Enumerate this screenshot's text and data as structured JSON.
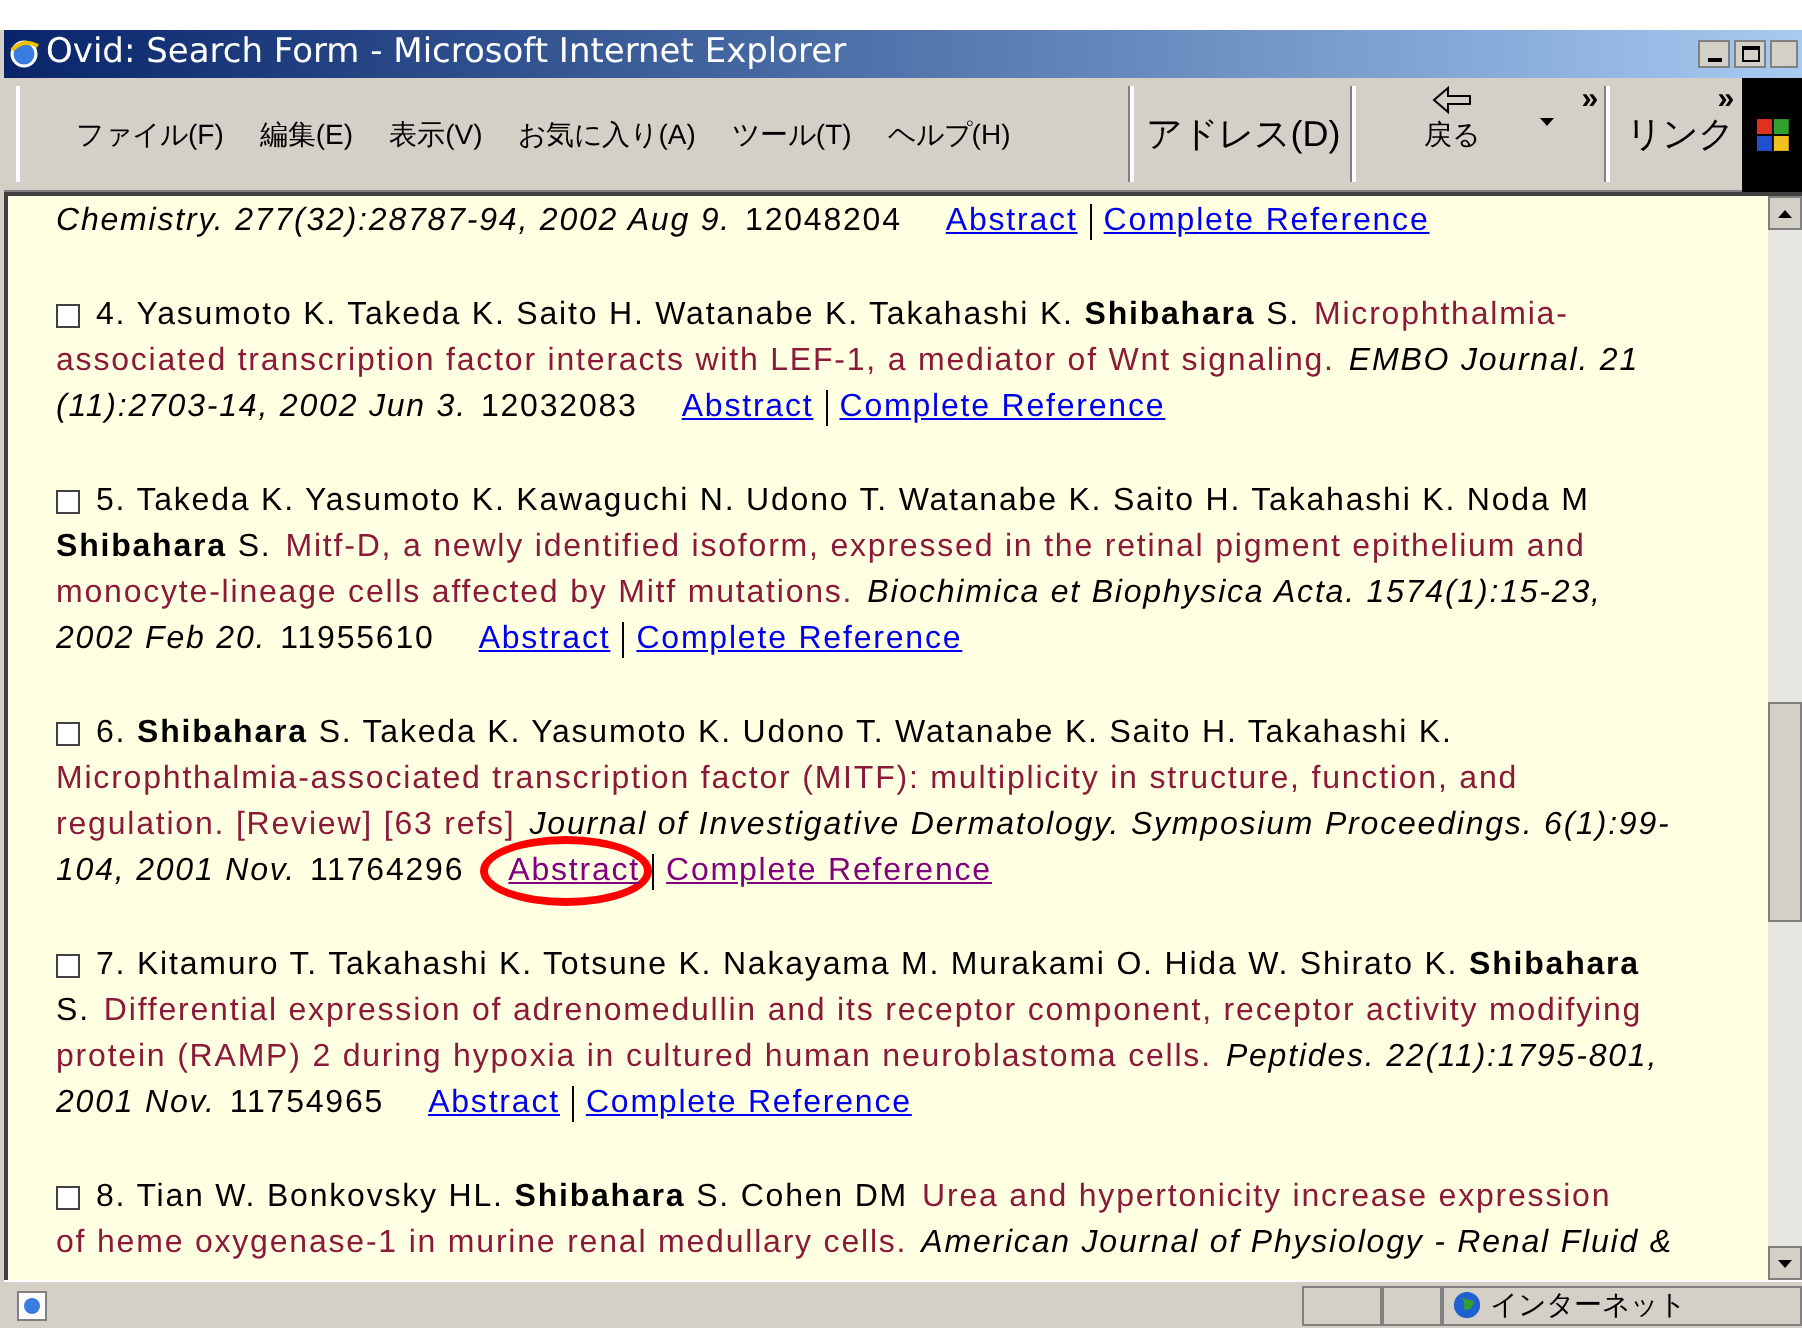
{
  "window": {
    "title": "Ovid: Search Form - Microsoft Internet Explorer"
  },
  "menu": [
    "ファイル(F)",
    "編集(E)",
    "表示(V)",
    "お気に入り(A)",
    "ツール(T)",
    "ヘルプ(H)"
  ],
  "toolbar": {
    "address_label": "アドレス(D)",
    "back_label": "戻る",
    "chevron": "»",
    "links_label": "リンク"
  },
  "records": [
    {
      "lines": [
        [
          {
            "kind": "journal",
            "text": "Chemistry. 277(32):28787-94, 2002 Aug 9."
          },
          {
            "kind": "pmid",
            "text": "12048204"
          },
          {
            "kind": "link",
            "text": "Abstract",
            "visited": false
          },
          {
            "kind": "link",
            "text": "Complete Reference",
            "visited": false
          }
        ]
      ]
    },
    {
      "checkbox": false,
      "lines": [
        [
          {
            "kind": "authors",
            "text": "4. Yasumoto K. Takeda K. Saito H. Watanabe K. Takahashi K. **Shibahara** S."
          },
          {
            "kind": "title",
            "text": "Microphthalmia-"
          }
        ],
        [
          {
            "kind": "title",
            "text": "associated transcription factor interacts with LEF-1, a mediator of Wnt signaling."
          },
          {
            "kind": "journal",
            "text": "EMBO Journal. 21"
          }
        ],
        [
          {
            "kind": "journal",
            "text": "(11):2703-14, 2002 Jun 3."
          },
          {
            "kind": "pmid",
            "text": "12032083"
          },
          {
            "kind": "link",
            "text": "Abstract",
            "visited": false
          },
          {
            "kind": "link",
            "text": "Complete Reference",
            "visited": false
          }
        ]
      ]
    },
    {
      "checkbox": false,
      "lines": [
        [
          {
            "kind": "authors",
            "text": "5. Takeda K. Yasumoto K. Kawaguchi N. Udono T. Watanabe K. Saito H. Takahashi K. Noda M"
          }
        ],
        [
          {
            "kind": "authors",
            "text": "**Shibahara** S."
          },
          {
            "kind": "title",
            "text": "Mitf-D, a newly identified isoform, expressed in the retinal pigment epithelium and"
          }
        ],
        [
          {
            "kind": "title",
            "text": "monocyte-lineage cells affected by Mitf mutations."
          },
          {
            "kind": "journal",
            "text": "Biochimica et Biophysica Acta. 1574(1):15-23,"
          }
        ],
        [
          {
            "kind": "journal",
            "text": "2002 Feb 20."
          },
          {
            "kind": "pmid",
            "text": "11955610"
          },
          {
            "kind": "link",
            "text": "Abstract",
            "visited": false
          },
          {
            "kind": "link",
            "text": "Complete Reference",
            "visited": false
          }
        ]
      ]
    },
    {
      "checkbox": false,
      "highlighted": true,
      "lines": [
        [
          {
            "kind": "authors",
            "text": "6. **Shibahara** S. Takeda K. Yasumoto K. Udono T. Watanabe K. Saito H. Takahashi K."
          }
        ],
        [
          {
            "kind": "title",
            "text": "Microphthalmia-associated transcription factor (MITF): multiplicity in structure, function, and"
          }
        ],
        [
          {
            "kind": "title",
            "text": "regulation. [Review] [63 refs]"
          },
          {
            "kind": "journal",
            "text": "Journal of Investigative Dermatology. Symposium Proceedings. 6(1):99-"
          }
        ],
        [
          {
            "kind": "journal",
            "text": "104, 2001 Nov."
          },
          {
            "kind": "pmid",
            "text": "11764296"
          },
          {
            "kind": "link",
            "text": "Abstract",
            "visited": true
          },
          {
            "kind": "link",
            "text": "Complete Reference",
            "visited": true
          }
        ]
      ]
    },
    {
      "checkbox": false,
      "lines": [
        [
          {
            "kind": "authors",
            "text": "7. Kitamuro T. Takahashi K. Totsune K. Nakayama M. Murakami O. Hida W. Shirato K. **Shibahara**"
          }
        ],
        [
          {
            "kind": "authors",
            "text": "S."
          },
          {
            "kind": "title",
            "text": "Differential expression of adrenomedullin and its receptor component, receptor activity modifying"
          }
        ],
        [
          {
            "kind": "title",
            "text": "protein (RAMP) 2 during hypoxia in cultured human neuroblastoma cells."
          },
          {
            "kind": "journal",
            "text": "Peptides. 22(11):1795-801,"
          }
        ],
        [
          {
            "kind": "journal",
            "text": "2001 Nov."
          },
          {
            "kind": "pmid",
            "text": "11754965"
          },
          {
            "kind": "link",
            "text": "Abstract",
            "visited": false
          },
          {
            "kind": "link",
            "text": "Complete Reference",
            "visited": false
          }
        ]
      ]
    },
    {
      "checkbox": false,
      "lines": [
        [
          {
            "kind": "authors",
            "text": "8. Tian W. Bonkovsky HL. **Shibahara** S. Cohen DM"
          },
          {
            "kind": "title",
            "text": "Urea and hypertonicity increase expression"
          }
        ],
        [
          {
            "kind": "title",
            "text": "of heme oxygenase-1 in murine renal medullary cells."
          },
          {
            "kind": "journal",
            "text": "American Journal of Physiology - Renal Fluid &"
          }
        ]
      ]
    }
  ],
  "status_bar": {
    "zone": "インターネット"
  }
}
